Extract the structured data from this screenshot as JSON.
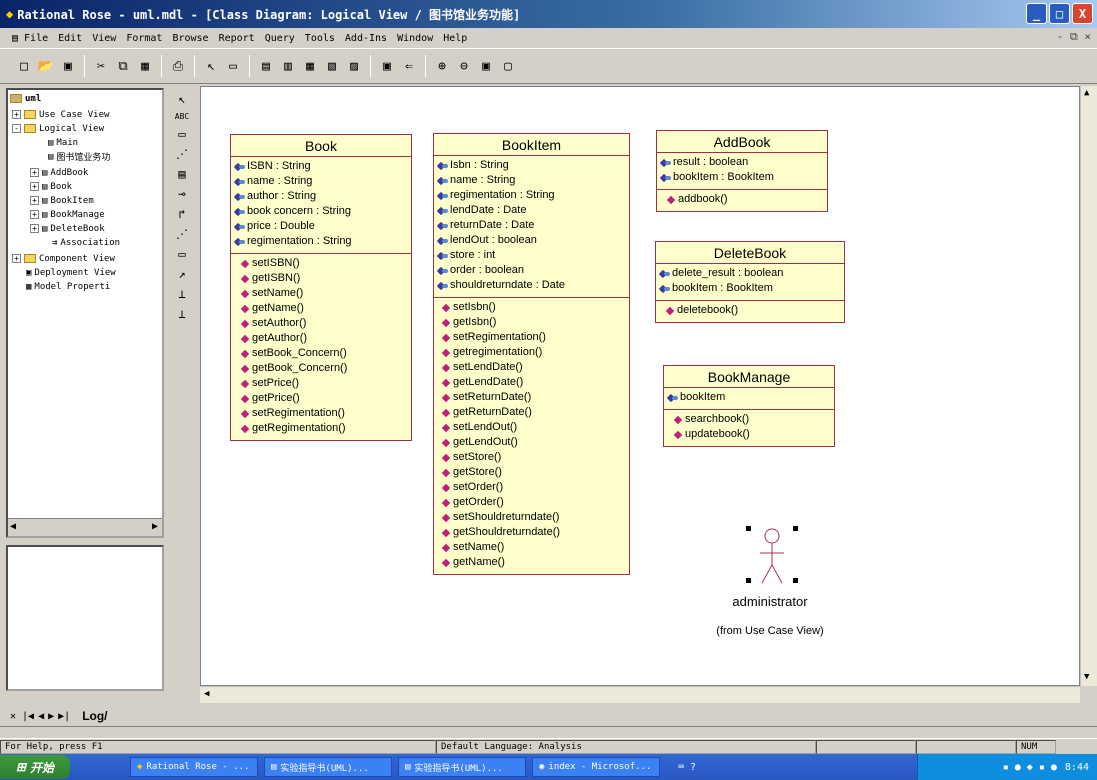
{
  "window": {
    "title": "Rational Rose - uml.mdl - [Class Diagram: Logical View / 图书馆业务功能]",
    "minimize": "_",
    "maximize": "□",
    "close": "X"
  },
  "menu": [
    "File",
    "Edit",
    "View",
    "Format",
    "Browse",
    "Report",
    "Query",
    "Tools",
    "Add-Ins",
    "Window",
    "Help"
  ],
  "mdi_controls": "- ⧉ ×",
  "tree": {
    "root": "uml",
    "use_case_view": "Use Case View",
    "logical_view": "Logical View",
    "main": "Main",
    "library": "图书馆业务功",
    "addbook": "AddBook",
    "book": "Book",
    "bookitem": "BookItem",
    "bookmanage": "BookManage",
    "deletebook": "DeleteBook",
    "association": "Association",
    "component_view": "Component View",
    "deployment_view": "Deployment View",
    "model_properties": "Model Properti"
  },
  "classes": {
    "book": {
      "name": "Book",
      "attributes": [
        "ISBN : String",
        "name : String",
        "author : String",
        "book concern : String",
        "price : Double",
        "regimentation : String"
      ],
      "operations": [
        "setISBN()",
        "getISBN()",
        "setName()",
        "getName()",
        "setAuthor()",
        "getAuthor()",
        "setBook_Concern()",
        "getBook_Concern()",
        "setPrice()",
        "getPrice()",
        "setRegimentation()",
        "getRegimentation()"
      ]
    },
    "bookitem": {
      "name": "BookItem",
      "attributes": [
        "Isbn : String",
        "name : String",
        "regimentation : String",
        "lendDate : Date",
        "returnDate : Date",
        "lendOut : boolean",
        "store : int",
        "order : boolean",
        "shouldreturndate : Date"
      ],
      "operations": [
        "setIsbn()",
        "getIsbn()",
        "setRegimentation()",
        "getregimentation()",
        "setLendDate()",
        "getLendDate()",
        "setReturnDate()",
        "getReturnDate()",
        "setLendOut()",
        "getLendOut()",
        "setStore()",
        "getStore()",
        "setOrder()",
        "getOrder()",
        "setShouldreturndate()",
        "getShouldreturndate()",
        "setName()",
        "getName()"
      ]
    },
    "addbook": {
      "name": "AddBook",
      "attributes": [
        "result : boolean",
        "bookItem : BookItem"
      ],
      "operations": [
        "addbook()"
      ]
    },
    "deletebook": {
      "name": "DeleteBook",
      "attributes": [
        "delete_result : boolean",
        "bookItem : BookItem"
      ],
      "operations": [
        "deletebook()"
      ]
    },
    "bookmanage": {
      "name": "BookManage",
      "attributes": [
        "bookItem"
      ],
      "operations": [
        "searchbook()",
        "updatebook()"
      ]
    }
  },
  "actor": {
    "name": "administrator",
    "from": "(from Use Case View)"
  },
  "log_tab": "Log/",
  "status": {
    "help": "For Help, press F1",
    "language": "Default Language: Analysis",
    "num": "NUM"
  },
  "taskbar": {
    "start": "开始",
    "tasks": [
      "Rational Rose - ...",
      "实验指导书(UML)...",
      "实验指导书(UML)...",
      "index - Microsof..."
    ],
    "clock": "8:44"
  }
}
